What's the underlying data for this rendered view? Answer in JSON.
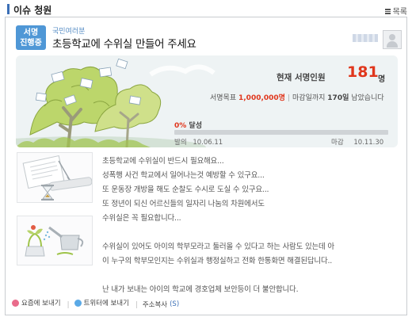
{
  "header": {
    "title": "이슈 청원",
    "list_label": "목록"
  },
  "petition": {
    "status_line1": "서명",
    "status_line2": "진행중",
    "category": "국민여러분",
    "title": "초등학교에 수위실 만들어 주세요"
  },
  "stats": {
    "count_label": "현재 서명인원",
    "count": "181",
    "count_unit": "명",
    "goal_label": "서명목표",
    "goal_value": "1,000,000명",
    "deadline_text_prefix": "마감일까지",
    "deadline_days": "170일",
    "deadline_text_suffix": "남았습니다",
    "progress_percent": 0,
    "progress_value": "0%",
    "progress_label": "달성",
    "start_label": "발의",
    "start_date": "10.06.11",
    "end_label": "마감",
    "end_date": "10.11.30"
  },
  "body": [
    "초등학교에 수위실이 반드시 필요해요...",
    "성폭행 사건 학교에서 일어나는것 예방할 수 있구요...",
    "또 운동장 개방을 해도 순찰도 수시로 도실 수 있구요...",
    "또 정년이 되신 어르신들의 일자리 나눔의 차원에서도",
    "수위실은 꼭 필요합니다...",
    "",
    "수위실이 있어도 아이의 학부모라고 둘러올 수 있다고 하는 사람도 있는데 아",
    "이 누구의 학부모인지는 수위실과 행정실하고 전화 한통화면 해결된답니다..",
    "",
    "난 내가 보내는 아이의 학교에 경호업체 보안등이 더 불안합니다."
  ],
  "footer": {
    "yozm": "요즘에 보내기",
    "twitter": "트위터에 보내기",
    "copy": "주소복사",
    "copy_count": "(S)"
  },
  "colors": {
    "accent": "#4f97d6",
    "count_red": "#e0361c",
    "progress_track": "#cfd3d6"
  }
}
